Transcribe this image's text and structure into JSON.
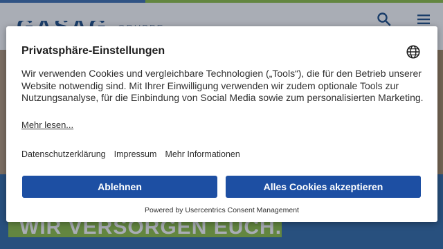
{
  "site": {
    "accent_colors": [
      "#3d6fb0",
      "#8fc043"
    ],
    "logo_text": "GASAG",
    "logo_subtext": "GRUPPE",
    "header_icons": [
      "search-icon",
      "menu-icon"
    ],
    "slogan": "WIR VERSORGEN EUCH."
  },
  "consent": {
    "title": "Privatsphäre-Einstellungen",
    "language_icon": "globe-icon",
    "body": "Wir verwenden Cookies und vergleichbare Technologien („Tools“), die für den Betrieb unserer Website notwendig sind. Mit Ihrer Einwilligung verwenden wir zudem optionale Tools zur Nutzungsanalyse, für die Einbindung von Social Media sowie zum personalisierten Marketing.",
    "more_link": "Mehr lesen...",
    "links": [
      "Datenschutzerklärung",
      "Impressum",
      "Mehr Informationen"
    ],
    "deny_label": "Ablehnen",
    "accept_label": "Alles Cookies akzeptieren",
    "powered_by": "Powered by Usercentrics Consent Management",
    "button_color": "#1d4fa3"
  }
}
